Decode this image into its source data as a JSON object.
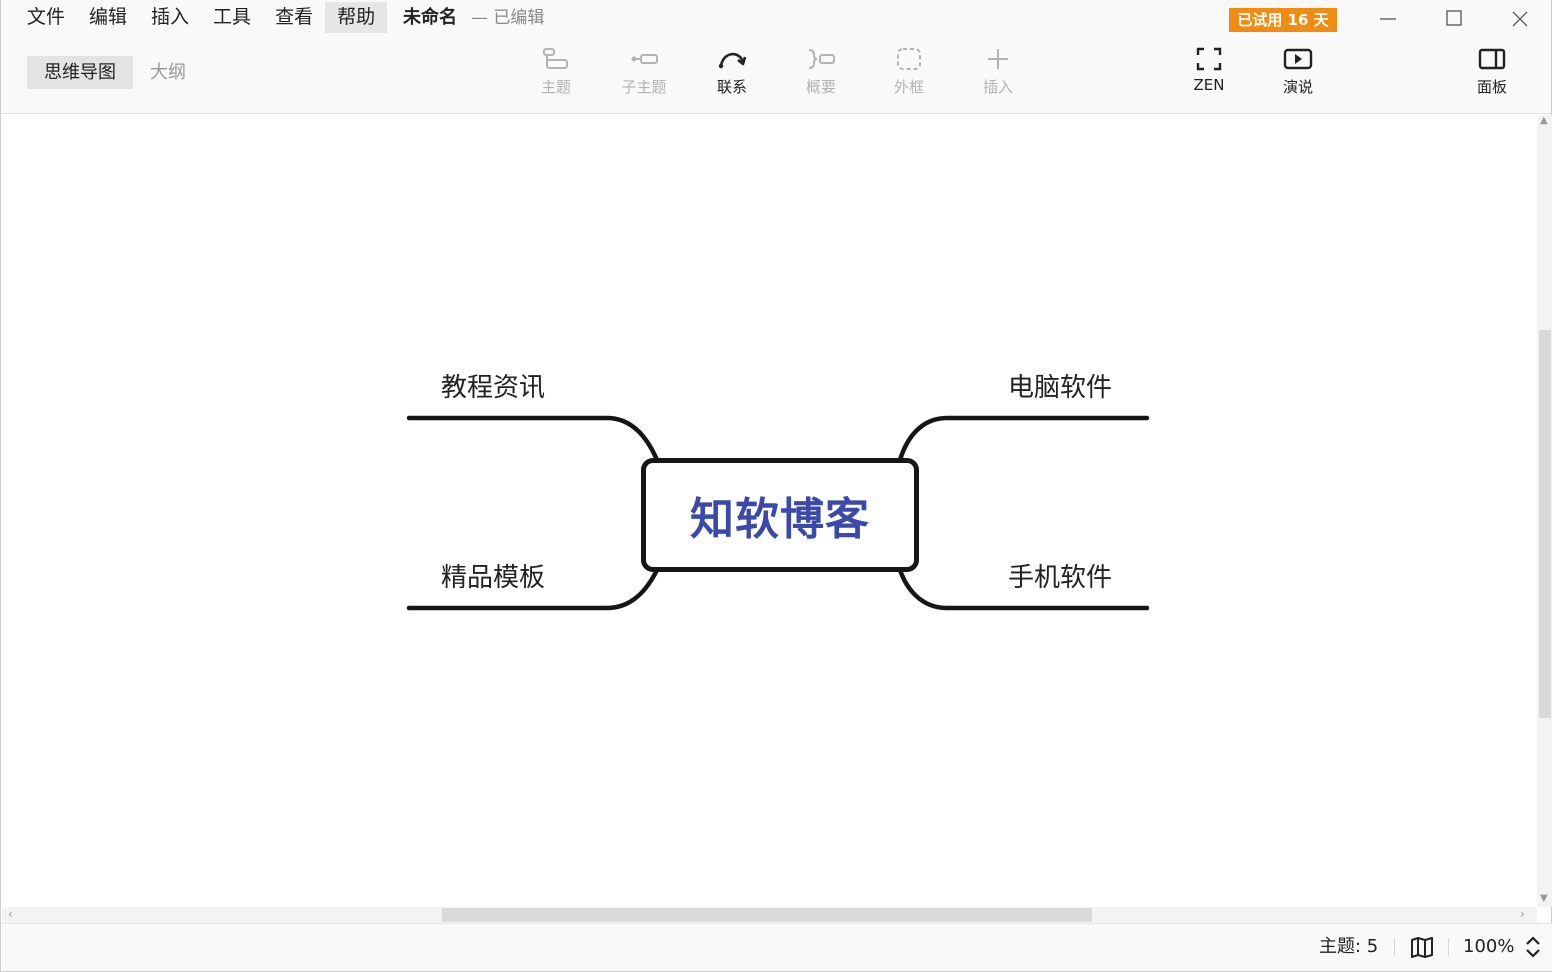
{
  "menu": {
    "items": [
      "文件",
      "编辑",
      "插入",
      "工具",
      "查看",
      "帮助"
    ],
    "active_index": 5
  },
  "document": {
    "title": "未命名",
    "status": "— 已编辑"
  },
  "trial_badge": "已试用 16 天",
  "view_toggle": {
    "mindmap": "思维导图",
    "outline": "大纲",
    "selected": "mindmap"
  },
  "toolbar": {
    "topic": "主题",
    "subtopic": "子主题",
    "relationship": "联系",
    "summary": "概要",
    "boundary": "外框",
    "insert": "插入",
    "zen": "ZEN",
    "present": "演说",
    "panel": "面板"
  },
  "mindmap": {
    "central": "知软博客",
    "central_color": "#3b4aa8",
    "branches": {
      "top_left": "教程资讯",
      "bottom_left": "精品模板",
      "top_right": "电脑软件",
      "bottom_right": "手机软件"
    }
  },
  "statusbar": {
    "topic_count": "主题: 5",
    "zoom": "100%"
  },
  "colors": {
    "trial_badge": "#f08c14",
    "line": "#161616"
  }
}
